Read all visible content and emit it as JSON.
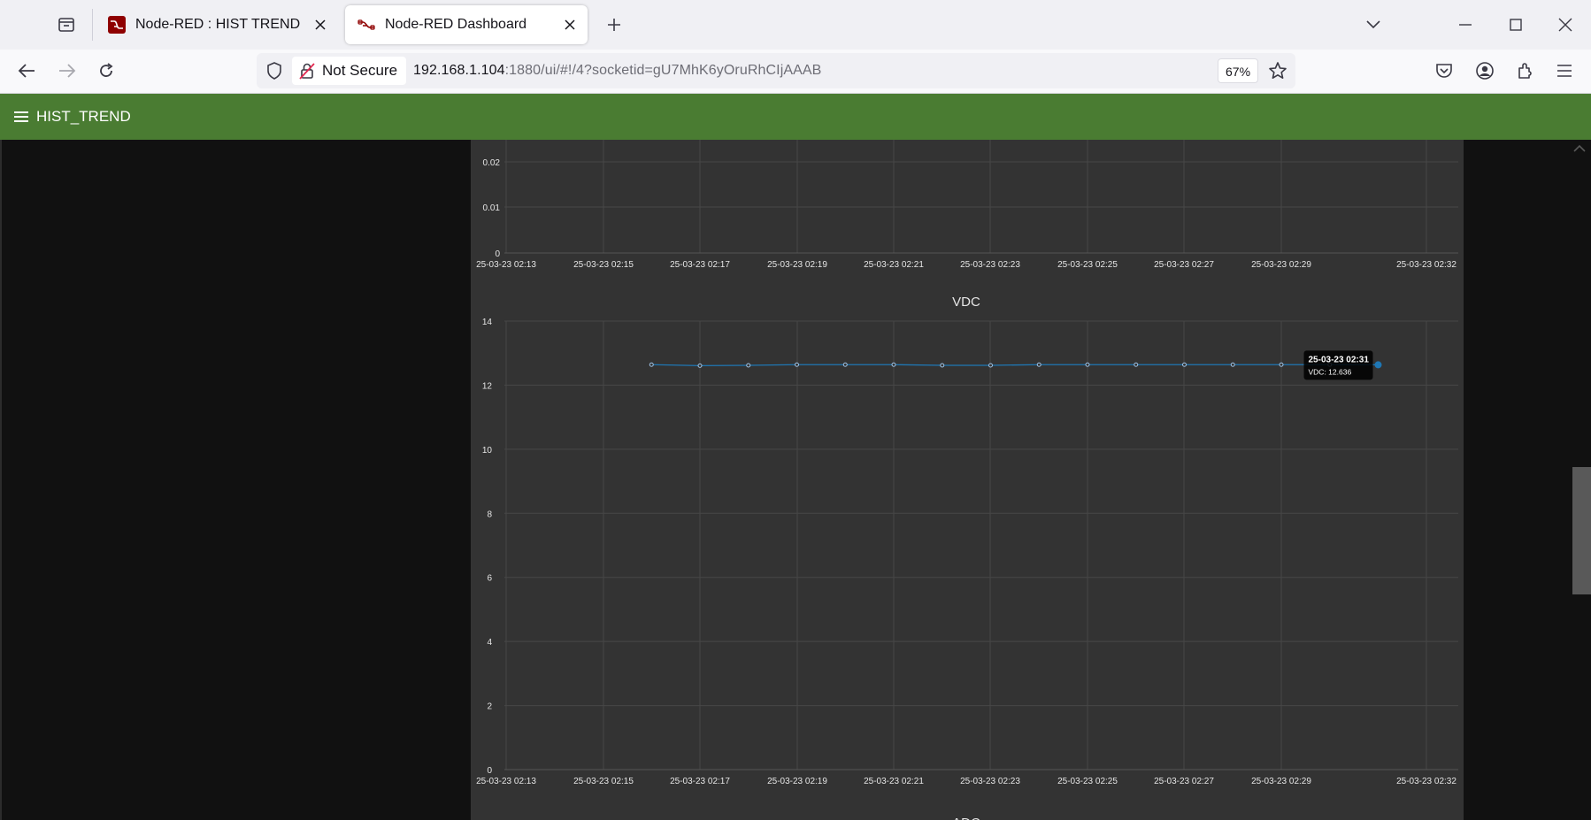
{
  "browser": {
    "tabs": [
      {
        "title": "Node-RED : HIST TREND",
        "active": false
      },
      {
        "title": "Node-RED Dashboard",
        "active": true
      }
    ],
    "security_label": "Not Secure",
    "url_host": "192.168.1.104",
    "url_path": ":1880/ui/#!/4?socketid=gU7MhK6yOruRhCIjAAAB",
    "zoom_label": "67%"
  },
  "dashboard": {
    "title": "HIST_TREND",
    "accent_color": "#4a7c32"
  },
  "chart_data": [
    {
      "type": "line",
      "title": "",
      "partially_visible": true,
      "y_ticks": [
        "0.02",
        "0.01",
        "0"
      ],
      "x_tick_labels": [
        "25-03-23 02:13",
        "25-03-23 02:15",
        "25-03-23 02:17",
        "25-03-23 02:19",
        "25-03-23 02:21",
        "25-03-23 02:23",
        "25-03-23 02:25",
        "25-03-23 02:27",
        "25-03-23 02:29",
        "25-03-23 02:32"
      ],
      "series": []
    },
    {
      "type": "line",
      "title": "VDC",
      "ylim": [
        0,
        14
      ],
      "y_ticks": [
        "14",
        "12",
        "10",
        "8",
        "6",
        "4",
        "2",
        "0"
      ],
      "x_tick_labels": [
        "25-03-23 02:13",
        "25-03-23 02:15",
        "25-03-23 02:17",
        "25-03-23 02:19",
        "25-03-23 02:21",
        "25-03-23 02:23",
        "25-03-23 02:25",
        "25-03-23 02:27",
        "25-03-23 02:29",
        "25-03-23 02:32"
      ],
      "line_color": "#1f77b4",
      "series": [
        {
          "name": "VDC",
          "x": [
            "02:16",
            "02:17",
            "02:18",
            "02:19",
            "02:20",
            "02:21",
            "02:22",
            "02:23",
            "02:24",
            "02:25",
            "02:26",
            "02:27",
            "02:28",
            "02:29",
            "02:30",
            "02:31"
          ],
          "values": [
            12.64,
            12.61,
            12.62,
            12.64,
            12.64,
            12.64,
            12.62,
            12.62,
            12.64,
            12.64,
            12.64,
            12.64,
            12.64,
            12.64,
            12.64,
            12.636
          ]
        }
      ],
      "tooltip": {
        "title": "25-03-23 02:31",
        "body": "VDC: 12.636"
      }
    },
    {
      "type": "line",
      "title": "ADC",
      "partially_visible": true,
      "series": []
    }
  ]
}
